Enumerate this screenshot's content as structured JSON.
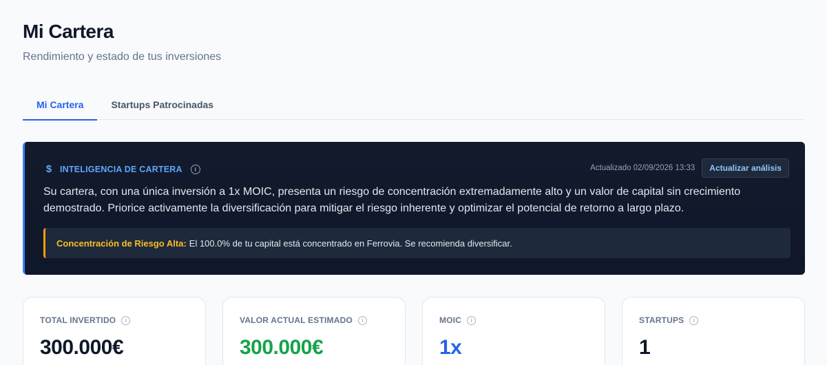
{
  "header": {
    "title": "Mi Cartera",
    "subtitle": "Rendimiento y estado de tus inversiones"
  },
  "tabs": [
    {
      "label": "Mi Cartera",
      "active": true
    },
    {
      "label": "Startups Patrocinadas",
      "active": false
    }
  ],
  "intelligence": {
    "icon": "dollar-icon",
    "label": "INTELIGENCIA DE CARTERA",
    "updated": "Actualizado 02/09/2026 13:33",
    "refresh_label": "Actualizar análisis",
    "summary": "Su cartera, con una única inversión a 1x MOIC, presenta un riesgo de concentración extremadamente alto y un valor de capital sin crecimiento demostrado. Priorice activamente la diversificación para mitigar el riesgo inherente y optimizar el potencial de retorno a largo plazo.",
    "alert": {
      "title": "Concentración de Riesgo Alta:",
      "text": "El 100.0% de tu capital está concentrado en Ferrovia. Se recomienda diversificar."
    }
  },
  "stats": [
    {
      "label": "TOTAL INVERTIDO",
      "value": "300.000€",
      "color": "#0f172a"
    },
    {
      "label": "VALOR ACTUAL ESTIMADO",
      "value": "300.000€",
      "color": "#16a34a"
    },
    {
      "label": "MOIC",
      "value": "1x",
      "color": "#2563eb"
    },
    {
      "label": "STARTUPS",
      "value": "1",
      "color": "#0f172a"
    }
  ],
  "colors": {
    "accent": "#2563eb",
    "warning": "#f59e0b",
    "dark_panel": "#0f172a"
  }
}
